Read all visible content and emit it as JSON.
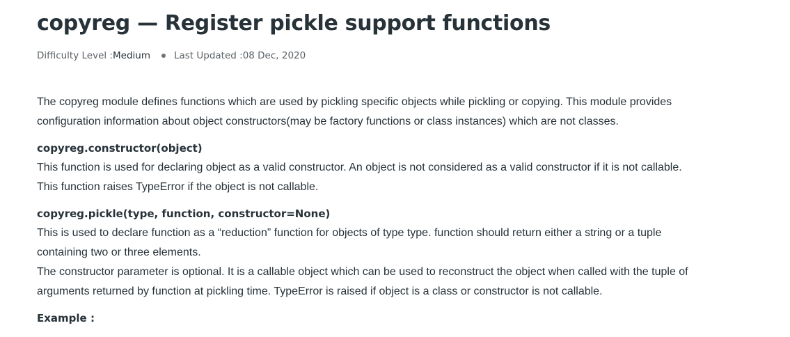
{
  "article": {
    "title": "copyreg — Register pickle support functions",
    "meta": {
      "difficulty_label": "Difficulty Level : ",
      "difficulty_value": "Medium",
      "updated_label": "Last Updated : ",
      "updated_value": "08 Dec, 2020"
    },
    "intro": [
      "The copyreg module defines functions which are used by pickling specific objects while pickling or copying. This module provides",
      "configuration information about object constructors(may be factory functions or class instances) which are not classes."
    ],
    "constructor_fn": {
      "signature": "copyreg.constructor(object)",
      "lines": [
        "This function is used for declaring object as a valid constructor. An object is not considered as a valid constructor if it is not callable.",
        "This function raises TypeError if the object is not callable."
      ]
    },
    "pickle_fn": {
      "signature": "copyreg.pickle(type, function, constructor=None)",
      "lines": [
        "This is used to declare function as a “reduction” function for objects of type type. function should return either a string or a tuple",
        "containing two or three elements.",
        "The constructor parameter is optional. It is a callable object which can be used to reconstruct the object when called with the tuple of",
        "arguments returned by function at pickling time. TypeError is raised if object is a class or constructor is not callable."
      ]
    },
    "example_label": "Example :"
  }
}
